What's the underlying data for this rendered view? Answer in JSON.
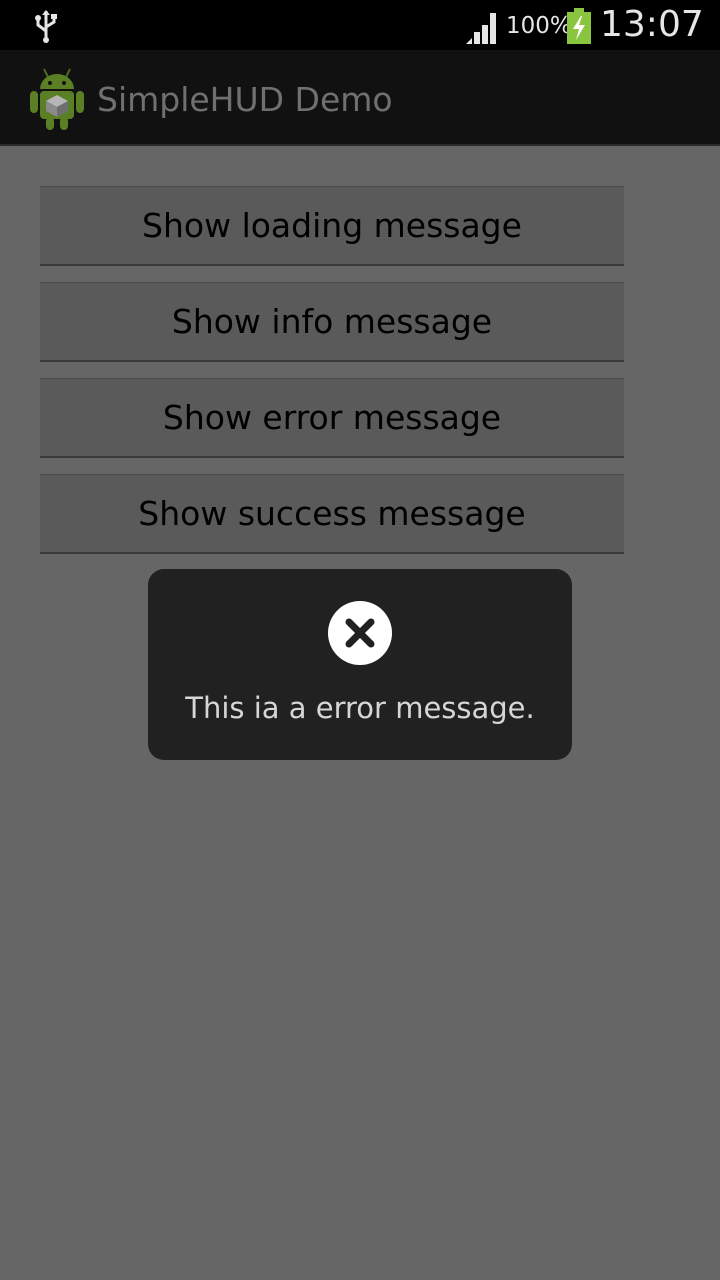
{
  "status_bar": {
    "battery_percent": "100%",
    "time": "13:07",
    "icons": [
      "usb-icon",
      "signal-icon",
      "battery-charging-icon"
    ]
  },
  "action_bar": {
    "app_icon": "android-app-icon",
    "title": "SimpleHUD Demo"
  },
  "buttons": [
    {
      "label": "Show loading message"
    },
    {
      "label": "Show info message"
    },
    {
      "label": "Show error message"
    },
    {
      "label": "Show success message"
    }
  ],
  "hud": {
    "icon": "close-circle-icon",
    "message": "This ia a error message."
  },
  "colors": {
    "background": "#666666",
    "action_bar": "#111111",
    "hud": "#212121",
    "battery_green": "#8ac53f"
  }
}
